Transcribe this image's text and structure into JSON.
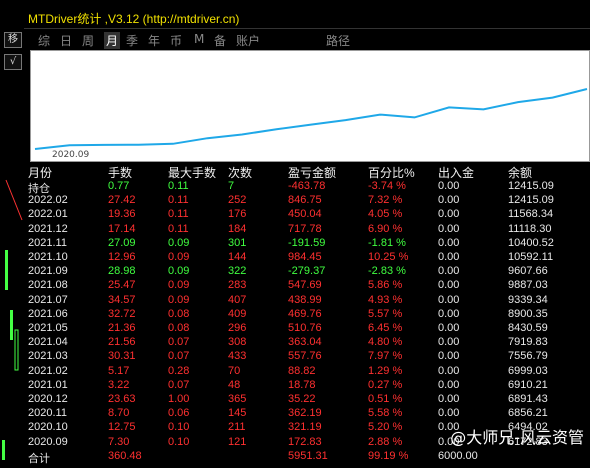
{
  "title": "MTDriver统计 ,V3.12 (http://mtdriver.cn)",
  "left_buttons": [
    "移",
    "√"
  ],
  "tabs": [
    {
      "label": "综",
      "active": false
    },
    {
      "label": "日",
      "active": false
    },
    {
      "label": "周",
      "active": false
    },
    {
      "label": "月",
      "active": true
    },
    {
      "label": "季",
      "active": false
    },
    {
      "label": "年",
      "active": false
    },
    {
      "label": "币",
      "active": false
    },
    {
      "label": "M",
      "active": false
    },
    {
      "label": "备",
      "active": false
    },
    {
      "label": "账户",
      "active": false
    },
    {
      "label": "路径",
      "active": false
    }
  ],
  "chart_data": {
    "type": "line",
    "x_label": "2020.09",
    "series": [
      {
        "values": [
          6484,
          6856,
          6891,
          6910,
          6999,
          7556,
          7919,
          8430,
          8900,
          9339,
          9887,
          9607,
          10592,
          10400,
          11118,
          11568,
          12415
        ]
      }
    ],
    "color": "#1fa8e8"
  },
  "table": {
    "headers": [
      "月份",
      "手数",
      "最大手数",
      "次数",
      "盈亏金额",
      "百分比%",
      "出入金",
      "余额"
    ],
    "rows": [
      {
        "c": [
          "持仓",
          "0.77",
          "0.11",
          "7",
          "-463.78",
          "-3.74 %",
          "0.00",
          "12415.09"
        ],
        "s": "pos"
      },
      {
        "c": [
          "2022.02",
          "27.42",
          "0.11",
          "252",
          "846.75",
          "7.32 %",
          "0.00",
          "12415.09"
        ],
        "s": "red"
      },
      {
        "c": [
          "2022.01",
          "19.36",
          "0.11",
          "176",
          "450.04",
          "4.05 %",
          "0.00",
          "11568.34"
        ],
        "s": "red"
      },
      {
        "c": [
          "2021.12",
          "17.14",
          "0.11",
          "184",
          "717.78",
          "6.90 %",
          "0.00",
          "11118.30"
        ],
        "s": "red"
      },
      {
        "c": [
          "2021.11",
          "27.09",
          "0.09",
          "301",
          "-191.59",
          "-1.81 %",
          "0.00",
          "10400.52"
        ],
        "s": "grn"
      },
      {
        "c": [
          "2021.10",
          "12.96",
          "0.09",
          "144",
          "984.45",
          "10.25 %",
          "0.00",
          "10592.11"
        ],
        "s": "red"
      },
      {
        "c": [
          "2021.09",
          "28.98",
          "0.09",
          "322",
          "-279.37",
          "-2.83 %",
          "0.00",
          "9607.66"
        ],
        "s": "grn"
      },
      {
        "c": [
          "2021.08",
          "25.47",
          "0.09",
          "283",
          "547.69",
          "5.86 %",
          "0.00",
          "9887.03"
        ],
        "s": "red"
      },
      {
        "c": [
          "2021.07",
          "34.57",
          "0.09",
          "407",
          "438.99",
          "4.93 %",
          "0.00",
          "9339.34"
        ],
        "s": "red"
      },
      {
        "c": [
          "2021.06",
          "32.72",
          "0.08",
          "409",
          "469.76",
          "5.57 %",
          "0.00",
          "8900.35"
        ],
        "s": "red"
      },
      {
        "c": [
          "2021.05",
          "21.36",
          "0.08",
          "296",
          "510.76",
          "6.45 %",
          "0.00",
          "8430.59"
        ],
        "s": "red"
      },
      {
        "c": [
          "2021.04",
          "21.56",
          "0.07",
          "308",
          "363.04",
          "4.80 %",
          "0.00",
          "7919.83"
        ],
        "s": "red"
      },
      {
        "c": [
          "2021.03",
          "30.31",
          "0.07",
          "433",
          "557.76",
          "7.97 %",
          "0.00",
          "7556.79"
        ],
        "s": "red"
      },
      {
        "c": [
          "2021.02",
          "5.17",
          "0.28",
          "70",
          "88.82",
          "1.29 %",
          "0.00",
          "6999.03"
        ],
        "s": "red"
      },
      {
        "c": [
          "2021.01",
          "3.22",
          "0.07",
          "48",
          "18.78",
          "0.27 %",
          "0.00",
          "6910.21"
        ],
        "s": "red"
      },
      {
        "c": [
          "2020.12",
          "23.63",
          "1.00",
          "365",
          "35.22",
          "0.51 %",
          "0.00",
          "6891.43"
        ],
        "s": "red"
      },
      {
        "c": [
          "2020.11",
          "8.70",
          "0.06",
          "145",
          "362.19",
          "5.58 %",
          "0.00",
          "6856.21"
        ],
        "s": "red"
      },
      {
        "c": [
          "2020.10",
          "12.75",
          "0.10",
          "211",
          "321.19",
          "5.20 %",
          "0.00",
          "6494.02"
        ],
        "s": "red"
      },
      {
        "c": [
          "2020.09",
          "7.30",
          "0.10",
          "121",
          "172.83",
          "2.88 %",
          "0.00",
          "6172.83"
        ],
        "s": "red"
      },
      {
        "c": [
          "合计",
          "360.48",
          "",
          "",
          "5951.31",
          "99.19 %",
          "6000.00",
          ""
        ],
        "s": "red"
      }
    ]
  },
  "watermark": "@大师兄-风云资管"
}
